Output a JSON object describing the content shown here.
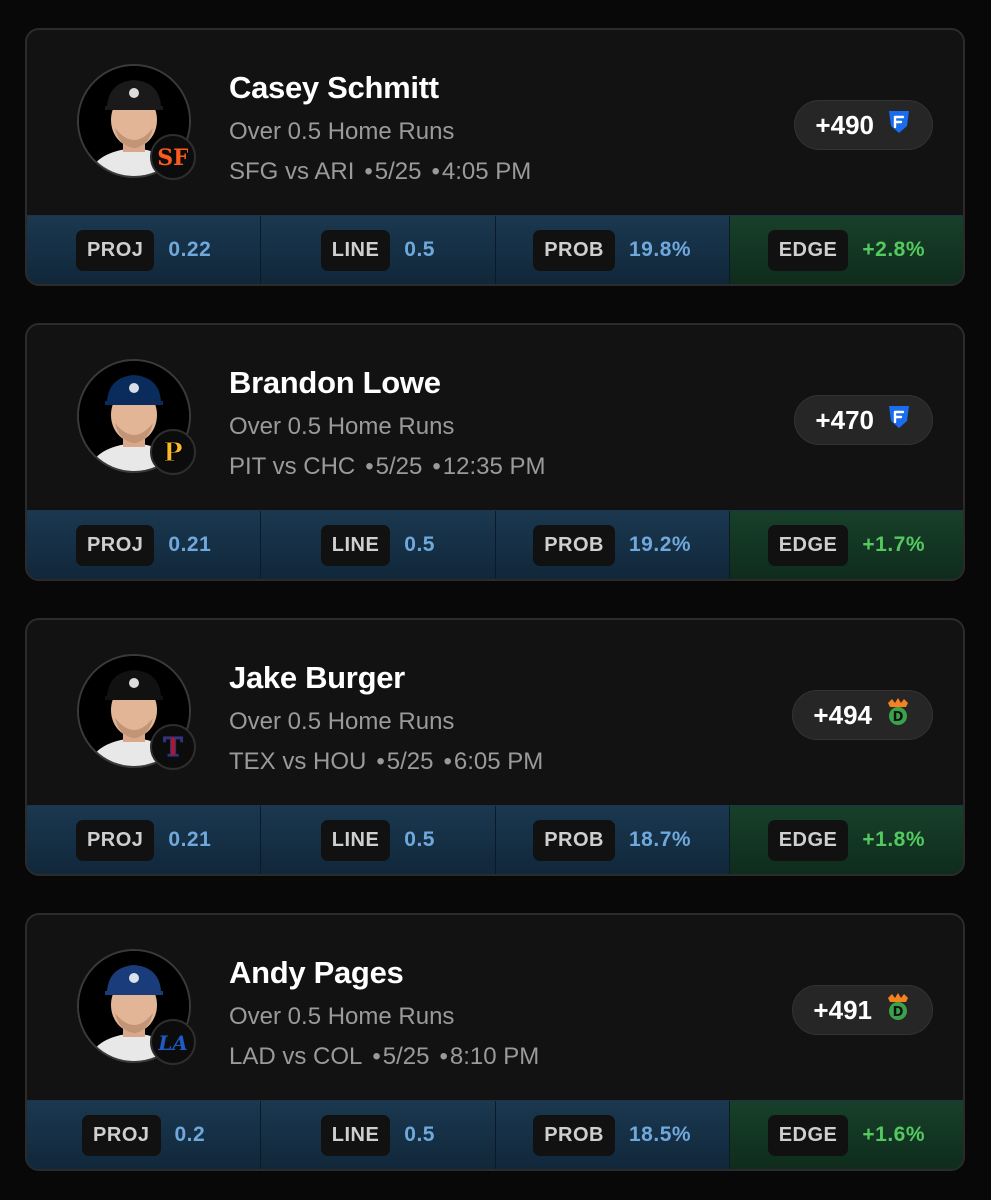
{
  "cards": [
    {
      "player": "Casey Schmitt",
      "market": "Over 0.5 Home Runs",
      "matchup": "SFG vs ARI",
      "date": "5/25",
      "time": "4:05 PM",
      "odds": "+490",
      "book_icon": "fanduel-icon",
      "team_icon": "giants-logo-icon",
      "team_color": "#fd5a1e",
      "cap_color": "#1a1a1a",
      "stats": [
        {
          "label": "PROJ",
          "value": "0.22"
        },
        {
          "label": "LINE",
          "value": "0.5"
        },
        {
          "label": "PROB",
          "value": "19.8%"
        },
        {
          "label": "EDGE",
          "value": "+2.8%"
        }
      ]
    },
    {
      "player": "Brandon Lowe",
      "market": "Over 0.5 Home Runs",
      "matchup": "PIT vs CHC",
      "date": "5/25",
      "time": "12:35 PM",
      "odds": "+470",
      "book_icon": "fanduel-icon",
      "team_icon": "pirates-logo-icon",
      "team_color": "#fdb827",
      "cap_color": "#092c5c",
      "stats": [
        {
          "label": "PROJ",
          "value": "0.21"
        },
        {
          "label": "LINE",
          "value": "0.5"
        },
        {
          "label": "PROB",
          "value": "19.2%"
        },
        {
          "label": "EDGE",
          "value": "+1.7%"
        }
      ]
    },
    {
      "player": "Jake Burger",
      "market": "Over 0.5 Home Runs",
      "matchup": "TEX vs HOU",
      "date": "5/25",
      "time": "6:05 PM",
      "odds": "+494",
      "book_icon": "draftkings-icon",
      "team_icon": "rangers-logo-icon",
      "team_color": "#c0111f",
      "cap_color": "#111111",
      "stats": [
        {
          "label": "PROJ",
          "value": "0.21"
        },
        {
          "label": "LINE",
          "value": "0.5"
        },
        {
          "label": "PROB",
          "value": "18.7%"
        },
        {
          "label": "EDGE",
          "value": "+1.8%"
        }
      ]
    },
    {
      "player": "Andy Pages",
      "market": "Over 0.5 Home Runs",
      "matchup": "LAD vs COL",
      "date": "5/25",
      "time": "8:10 PM",
      "odds": "+491",
      "book_icon": "draftkings-icon",
      "team_icon": "dodgers-logo-icon",
      "team_color": "#1e5bc6",
      "cap_color": "#1a3c7a",
      "stats": [
        {
          "label": "PROJ",
          "value": "0.2"
        },
        {
          "label": "LINE",
          "value": "0.5"
        },
        {
          "label": "PROB",
          "value": "18.5%"
        },
        {
          "label": "EDGE",
          "value": "+1.6%"
        }
      ]
    }
  ]
}
